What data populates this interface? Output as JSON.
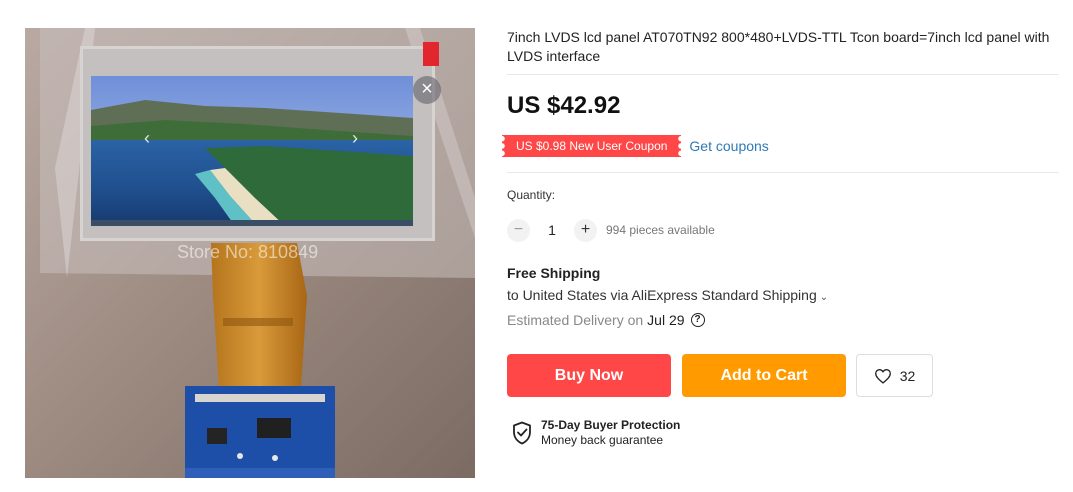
{
  "product": {
    "title": "7inch LVDS lcd panel AT070TN92 800*480+LVDS-TTL Tcon board=7inch lcd panel with LVDS interface",
    "price": "US $42.92"
  },
  "gallery": {
    "watermark": "Store No: 810849",
    "close_icon": "close-icon",
    "prev_icon": "chevron-left-icon",
    "next_icon": "chevron-right-icon"
  },
  "coupon": {
    "badge": "US $0.98 New User Coupon",
    "link": "Get coupons",
    "color": "#ff4747"
  },
  "quantity": {
    "label": "Quantity:",
    "minus": "−",
    "value": "1",
    "plus": "+",
    "available": "994 pieces available"
  },
  "shipping": {
    "title": "Free Shipping",
    "line": "to United States via AliExpress Standard Shipping",
    "delivery_label": "Estimated Delivery on",
    "delivery_date": "Jul 29",
    "help_icon": "question-circle-icon"
  },
  "actions": {
    "buy_now": "Buy Now",
    "add_to_cart": "Add to Cart",
    "wishlist_count": "32",
    "buy_color": "#ff4747",
    "cart_color": "#ff9a00"
  },
  "protection": {
    "title": "75-Day Buyer Protection",
    "subtitle": "Money back guarantee",
    "icon": "shield-check-icon"
  }
}
